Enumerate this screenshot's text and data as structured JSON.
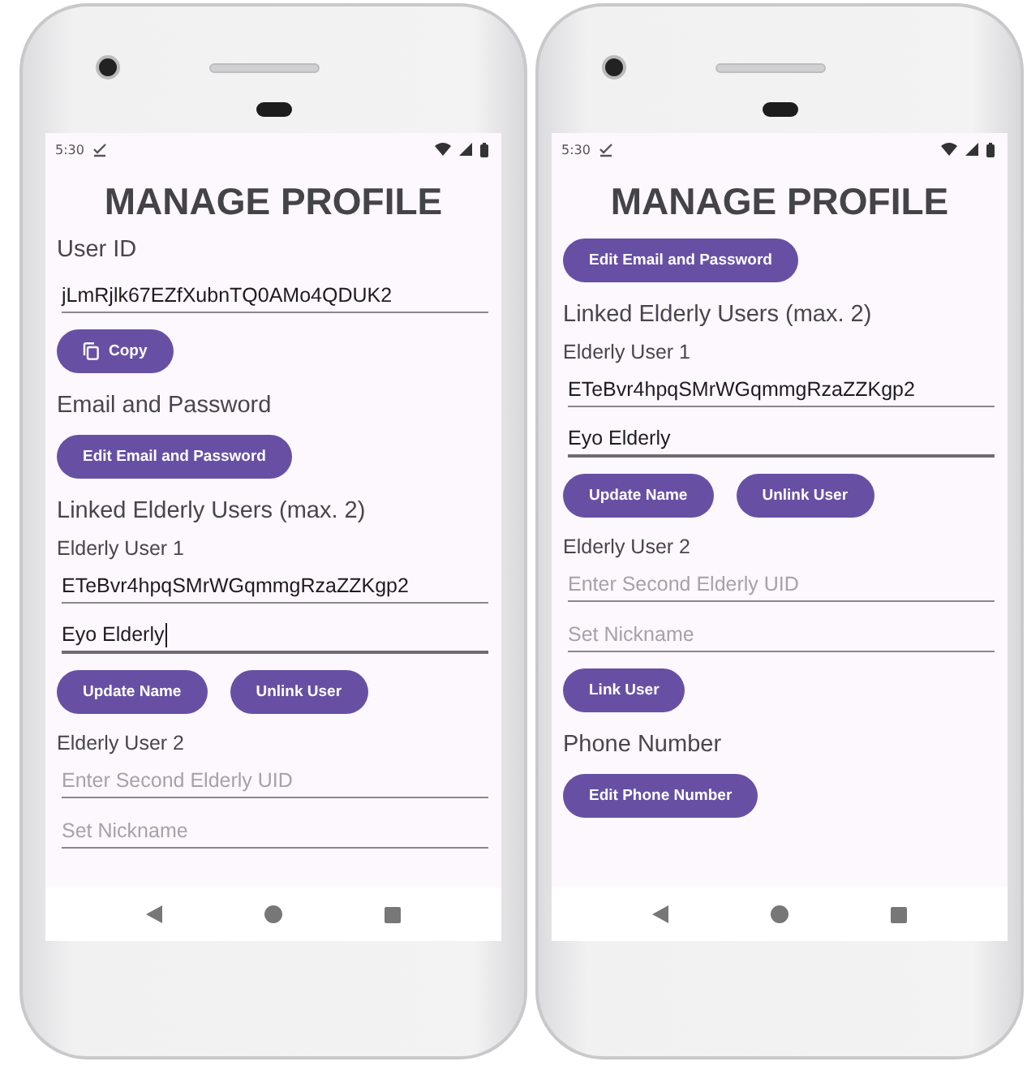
{
  "phones": [
    {
      "status_bar": {
        "time": "5:30"
      },
      "title": "MANAGE PROFILE",
      "items": [
        {
          "kind": "heading",
          "text": "User ID"
        },
        {
          "kind": "field",
          "value": "jLmRjlk67EZfXubnTQ0AMo4QDUK2",
          "focused": false,
          "cursor": false
        },
        {
          "kind": "buttons",
          "buttons": [
            {
              "label": "Copy",
              "kind": "copy"
            }
          ]
        },
        {
          "kind": "heading",
          "text": "Email and Password"
        },
        {
          "kind": "buttons",
          "buttons": [
            {
              "label": "Edit Email and Password"
            }
          ]
        },
        {
          "kind": "heading",
          "text": "Linked Elderly Users (max. 2)"
        },
        {
          "kind": "label",
          "text": "Elderly User 1"
        },
        {
          "kind": "field",
          "value": "ETeBvr4hpqSMrWGqmmgRzaZZKgp2",
          "focused": false,
          "cursor": false
        },
        {
          "kind": "field",
          "value": "Eyo Elderly",
          "focused": true,
          "cursor": true
        },
        {
          "kind": "buttons",
          "buttons": [
            {
              "label": "Update Name"
            },
            {
              "label": "Unlink User"
            }
          ]
        },
        {
          "kind": "label",
          "text": "Elderly User 2"
        },
        {
          "kind": "field",
          "placeholder": "Enter Second Elderly UID",
          "focused": false,
          "cursor": false
        },
        {
          "kind": "field",
          "placeholder": "Set Nickname",
          "focused": false,
          "cursor": false
        }
      ]
    },
    {
      "status_bar": {
        "time": "5:30"
      },
      "title": "MANAGE PROFILE",
      "items": [
        {
          "kind": "buttons",
          "buttons": [
            {
              "label": "Edit Email and Password"
            }
          ]
        },
        {
          "kind": "heading",
          "text": "Linked Elderly Users (max. 2)"
        },
        {
          "kind": "label",
          "text": "Elderly User 1"
        },
        {
          "kind": "field",
          "value": "ETeBvr4hpqSMrWGqmmgRzaZZKgp2",
          "focused": false,
          "cursor": false
        },
        {
          "kind": "field",
          "value": "Eyo Elderly",
          "focused": true,
          "cursor": false
        },
        {
          "kind": "buttons",
          "buttons": [
            {
              "label": "Update Name"
            },
            {
              "label": "Unlink User"
            }
          ]
        },
        {
          "kind": "label",
          "text": "Elderly User 2"
        },
        {
          "kind": "field",
          "placeholder": "Enter Second Elderly UID",
          "focused": false,
          "cursor": false
        },
        {
          "kind": "field",
          "placeholder": "Set Nickname",
          "focused": false,
          "cursor": false
        },
        {
          "kind": "buttons",
          "buttons": [
            {
              "label": "Link User"
            }
          ]
        },
        {
          "kind": "heading",
          "text": "Phone Number"
        },
        {
          "kind": "buttons",
          "buttons": [
            {
              "label": "Edit Phone Number"
            }
          ]
        }
      ]
    }
  ]
}
